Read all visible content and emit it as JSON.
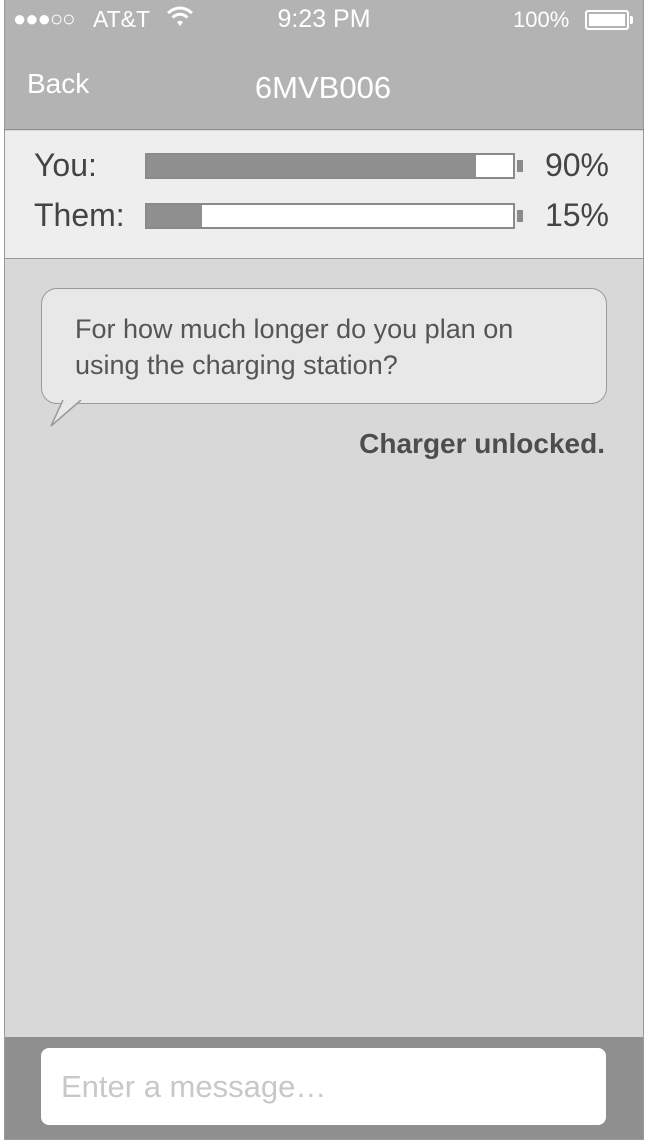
{
  "status_bar": {
    "signal": "●●●○○",
    "carrier": "AT&T",
    "time": "9:23 PM",
    "battery_percent": "100%"
  },
  "nav": {
    "back_label": "Back",
    "title": "6MVB006"
  },
  "charge_status": [
    {
      "label": "You:",
      "percent_text": "90%",
      "level": 0.9
    },
    {
      "label": "Them:",
      "percent_text": "15%",
      "level": 0.15
    }
  ],
  "chat": {
    "message": "For how much longer do you plan on using the charging station?",
    "system_message": "Charger unlocked."
  },
  "composer": {
    "placeholder": "Enter a message…"
  },
  "colors": {
    "nav_background": "#b3b3b3",
    "bar_fill": "#8f8f8f",
    "chat_background": "#d8d8d8"
  }
}
